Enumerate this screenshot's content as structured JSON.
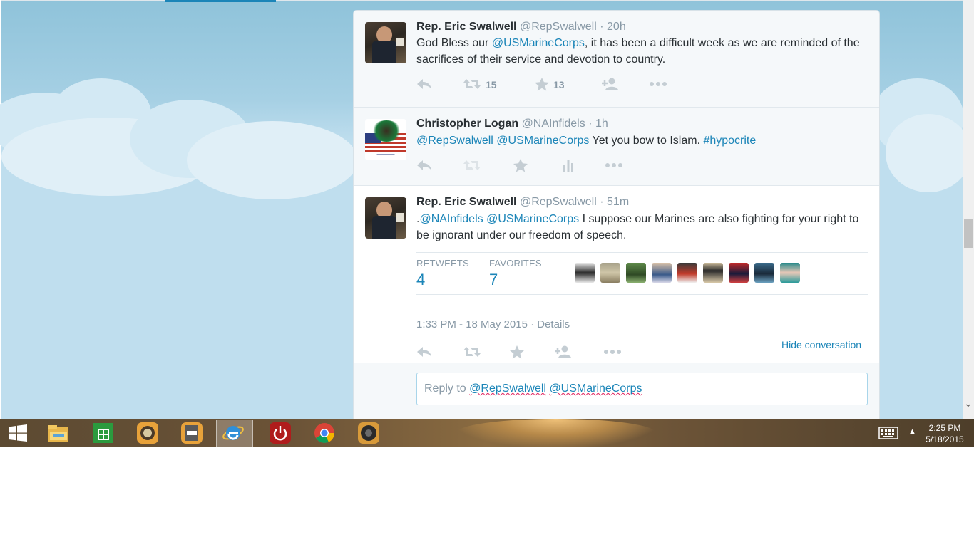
{
  "tweets": [
    {
      "fullname": "Rep. Eric Swalwell",
      "handle": "@RepSwalwell",
      "time": "· 20h",
      "text_segments": [
        {
          "t": "God Bless our ",
          "link": false
        },
        {
          "t": "@USMarineCorps",
          "link": true
        },
        {
          "t": ", it has been a difficult week as we are reminded of the sacrifices of their service and devotion to country.",
          "link": false
        }
      ],
      "retweet_count": "15",
      "favorite_count": "13"
    },
    {
      "fullname": "Christopher Logan",
      "handle": "@NAInfidels",
      "time": "· 1h",
      "text_segments": [
        {
          "t": "@RepSwalwell",
          "link": true
        },
        {
          "t": " ",
          "link": false
        },
        {
          "t": "@USMarineCorps",
          "link": true
        },
        {
          "t": " Yet you bow to Islam. ",
          "link": false
        },
        {
          "t": "#hypocrite",
          "link": true
        }
      ]
    },
    {
      "fullname": "Rep. Eric Swalwell",
      "handle": "@RepSwalwell",
      "time": "· 51m",
      "text_segments": [
        {
          "t": ".",
          "link": false
        },
        {
          "t": "@NAInfidels",
          "link": true
        },
        {
          "t": " ",
          "link": false
        },
        {
          "t": "@USMarineCorps",
          "link": true
        },
        {
          "t": " I suppose our Marines are also fighting for your right to be ignorant under our freedom of speech.",
          "link": false
        }
      ],
      "retweets_label": "RETWEETS",
      "retweets_value": "4",
      "favorites_label": "FAVORITES",
      "favorites_value": "7",
      "timestamp": "1:33 PM - 18 May 2015",
      "details_label": "· Details",
      "hide_conversation": "Hide conversation"
    }
  ],
  "reply": {
    "prefix": "Reply to ",
    "mention1": "@RepSwalwell",
    "mention2": "@USMarineCorps"
  },
  "taskbar": {
    "time": "2:25 PM",
    "date": "5/18/2015",
    "icons": [
      "windows-start-icon",
      "file-explorer-icon",
      "store-icon",
      "app-icon",
      "doc-icon",
      "internet-explorer-icon",
      "power-icon",
      "chrome-icon",
      "speaker-app-icon"
    ]
  },
  "colors": {
    "link": "#1b85b8",
    "text": "#292f33",
    "muted": "#8899a6"
  }
}
